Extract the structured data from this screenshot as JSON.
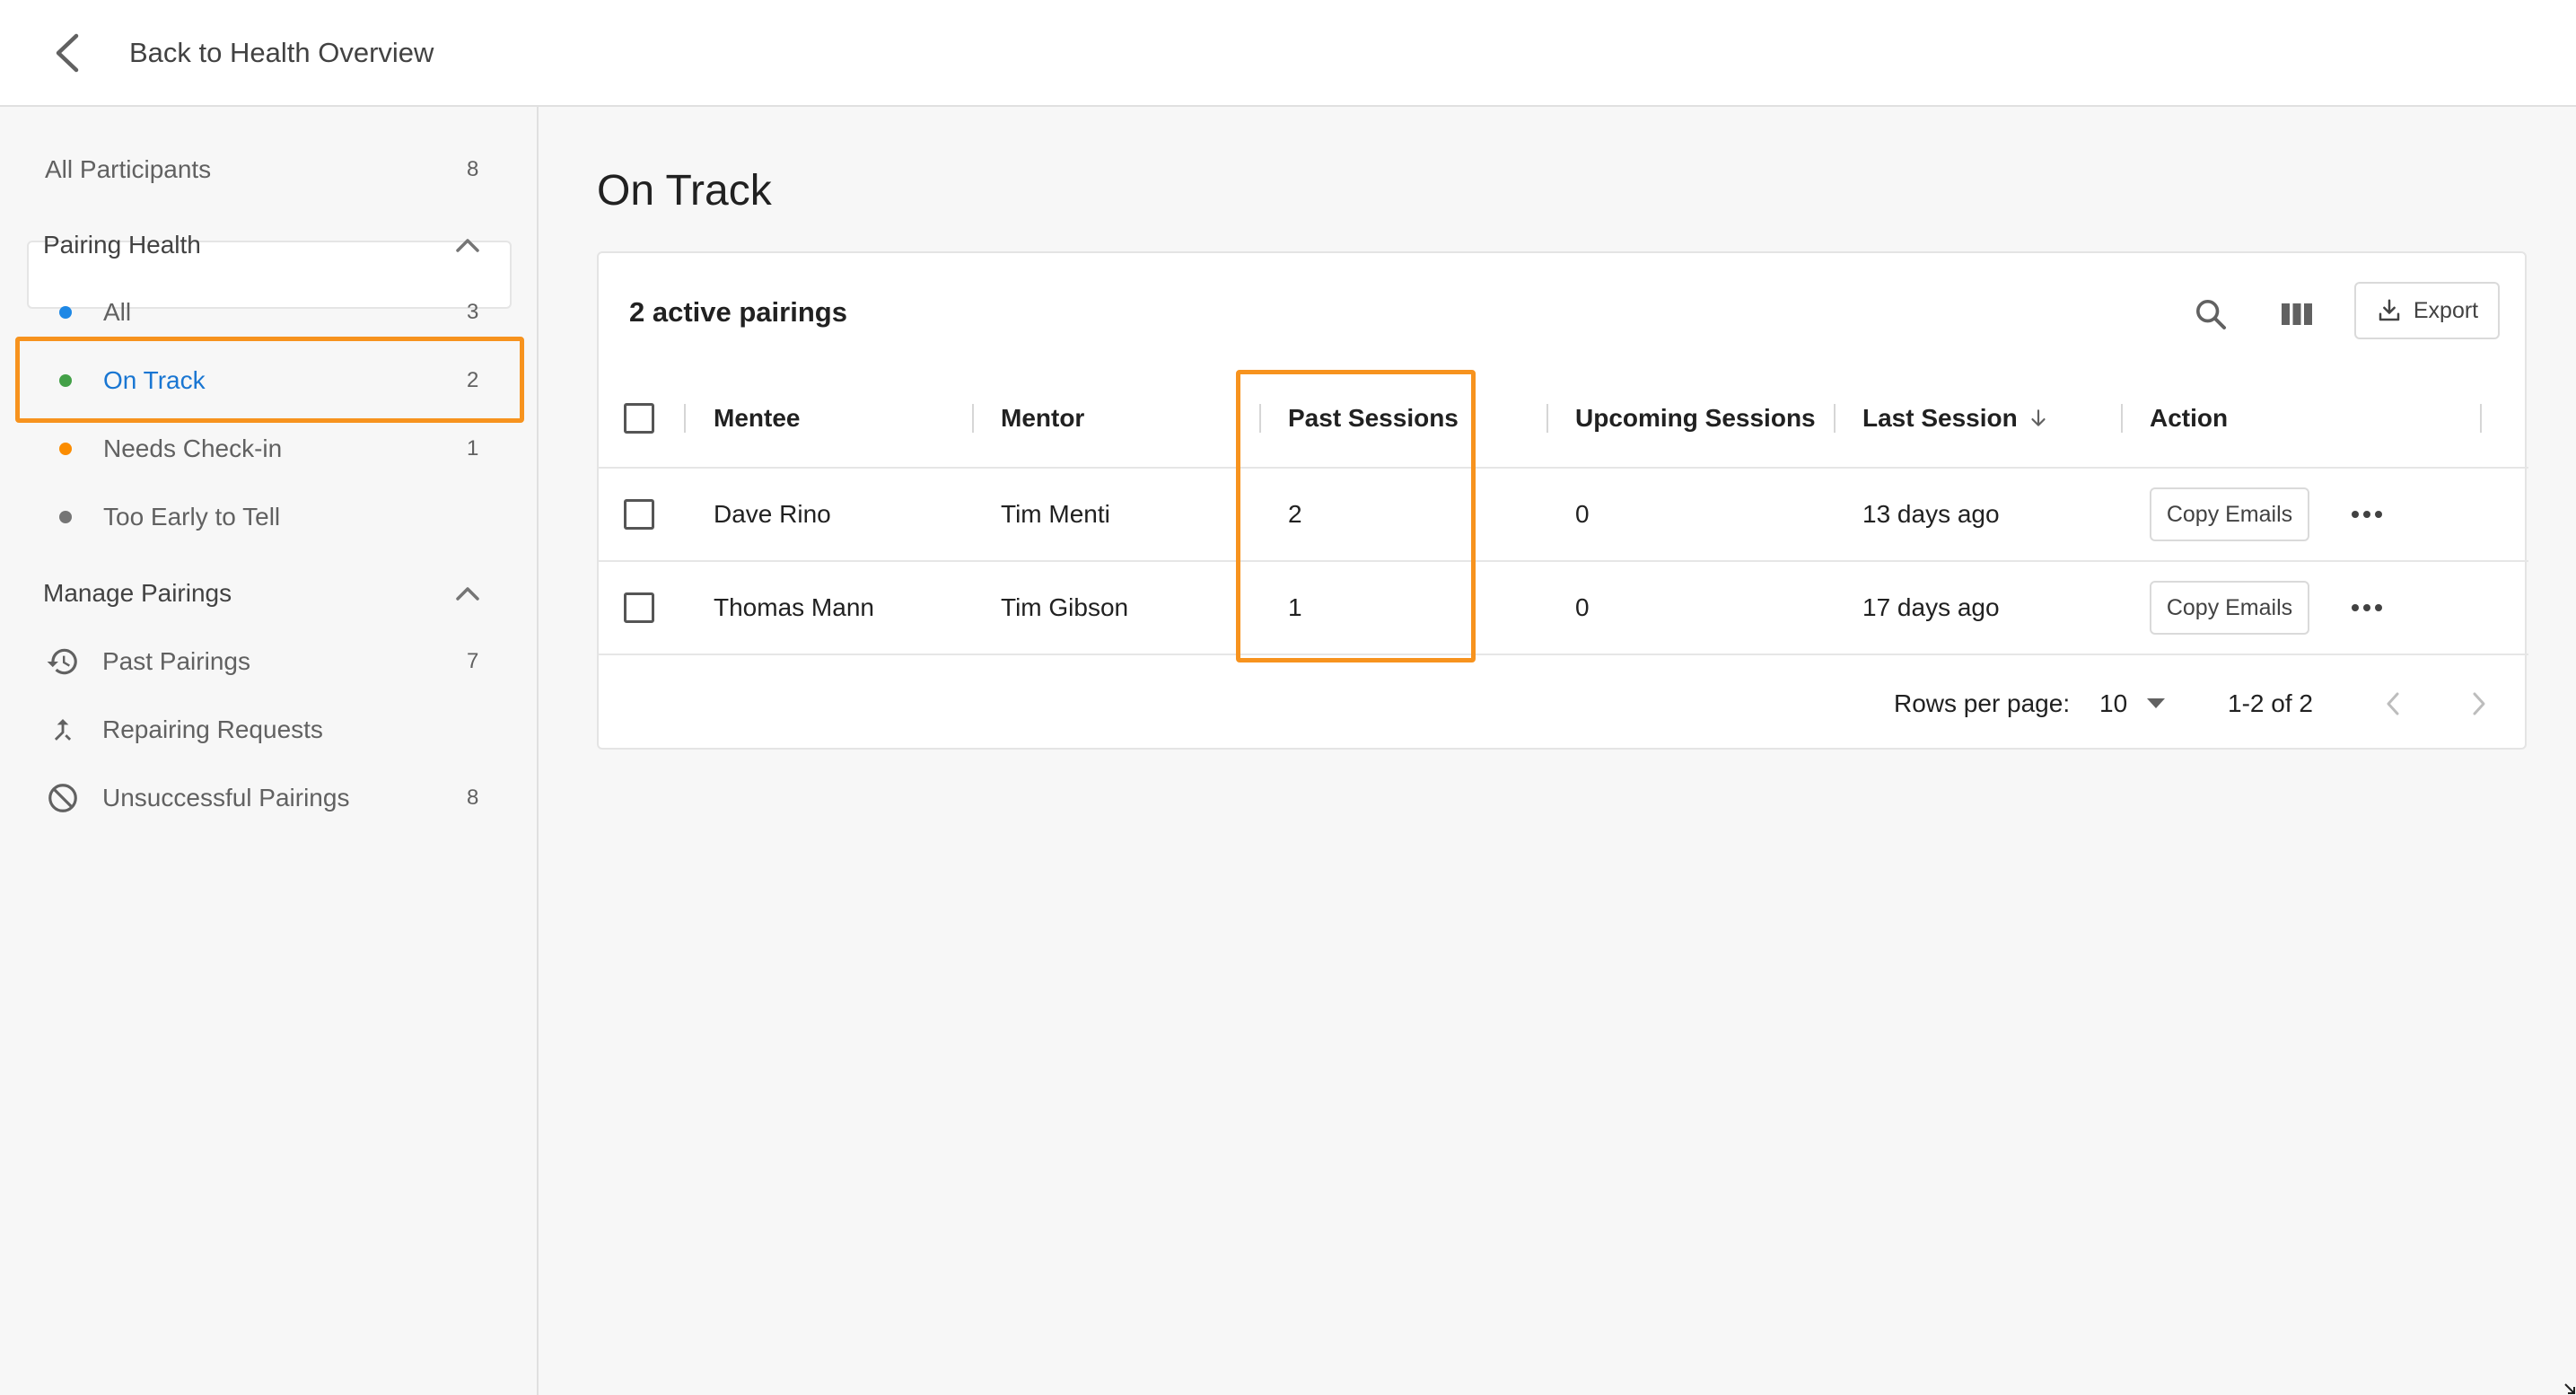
{
  "header": {
    "back_label": "Back to Health Overview"
  },
  "sidebar": {
    "all_participants": {
      "label": "All Participants",
      "count": "8"
    },
    "pairing_health": {
      "title": "Pairing Health",
      "items": [
        {
          "label": "All",
          "count": "3",
          "dot_color": "#1e88e5"
        },
        {
          "label": "On Track",
          "count": "2",
          "dot_color": "#43a047"
        },
        {
          "label": "Needs Check-in",
          "count": "1",
          "dot_color": "#fb8c00"
        },
        {
          "label": "Too Early to Tell",
          "count": "",
          "dot_color": "#757575"
        }
      ]
    },
    "manage_pairings": {
      "title": "Manage Pairings",
      "items": [
        {
          "label": "Past Pairings",
          "count": "7",
          "icon": "history-icon"
        },
        {
          "label": "Repairing Requests",
          "count": "",
          "icon": "merge-icon"
        },
        {
          "label": "Unsuccessful Pairings",
          "count": "8",
          "icon": "block-icon"
        }
      ]
    }
  },
  "main": {
    "title": "On Track",
    "card_title": "2 active pairings",
    "export_label": "Export",
    "columns": [
      "Mentee",
      "Mentor",
      "Past Sessions",
      "Upcoming Sessions",
      "Last Session",
      "Action"
    ],
    "rows": [
      {
        "mentee": "Dave Rino",
        "mentor": "Tim Menti",
        "past": "2",
        "upcoming": "0",
        "last": "13 days ago",
        "action": "Copy Emails"
      },
      {
        "mentee": "Thomas Mann",
        "mentor": "Tim Gibson",
        "past": "1",
        "upcoming": "0",
        "last": "17 days ago",
        "action": "Copy Emails"
      }
    ],
    "pagination": {
      "rows_per_page_label": "Rows per page:",
      "rows_per_page": "10",
      "range": "1-2 of 2"
    }
  },
  "colors": {
    "accent": "#1976d2",
    "highlight": "#f7931e"
  }
}
